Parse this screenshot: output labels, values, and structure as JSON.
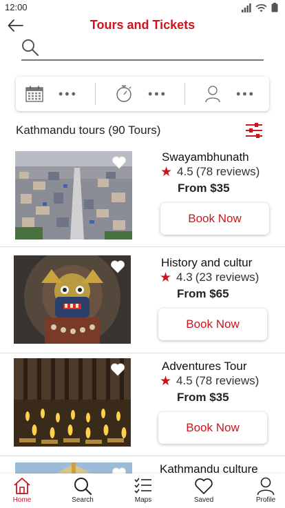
{
  "status": {
    "time": "12:00"
  },
  "header": {
    "title": "Tours and Tickets"
  },
  "search": {
    "placeholder": "",
    "value": ""
  },
  "list": {
    "heading": "Kathmandu tours (90 Tours)"
  },
  "tours": [
    {
      "name": "Swayambhunath",
      "rating": "4.5",
      "reviews": "(78 reviews)",
      "price": "From $35",
      "button": "Book Now",
      "image": "aerial-city-photo"
    },
    {
      "name": "History and cultur",
      "rating": "4.3",
      "reviews": "(23 reviews)",
      "price": "From $65",
      "button": "Book Now",
      "image": "bhairav-statue-photo"
    },
    {
      "name": "Adventures Tour",
      "rating": "4.5",
      "reviews": "(78 reviews)",
      "price": "From $35",
      "button": "Book Now",
      "image": "butter-lamps-photo"
    },
    {
      "name": "Kathmandu culture",
      "image": "stupa-photo"
    }
  ],
  "nav": {
    "home": "Home",
    "search": "Search",
    "maps": "Maps",
    "saved": "Saved",
    "profile": "Profile"
  },
  "colors": {
    "accent": "#c8161d"
  }
}
